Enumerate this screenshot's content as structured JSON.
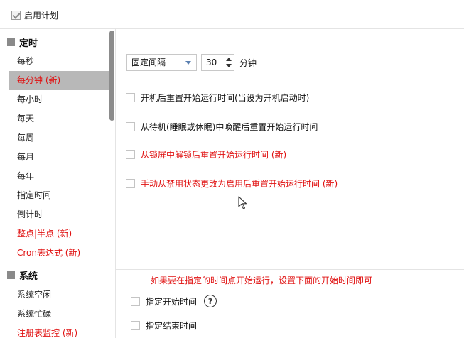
{
  "enable_plan": {
    "label": "启用计划",
    "checked": true
  },
  "sidebar": {
    "groups": [
      {
        "title": "定时"
      },
      {
        "title": "系统"
      }
    ],
    "items": [
      {
        "label": "每秒",
        "highlight": false
      },
      {
        "label": "每分钟 (新)",
        "highlight": true,
        "selected": true
      },
      {
        "label": "每小时",
        "highlight": false
      },
      {
        "label": "每天",
        "highlight": false
      },
      {
        "label": "每周",
        "highlight": false
      },
      {
        "label": "每月",
        "highlight": false
      },
      {
        "label": "每年",
        "highlight": false
      },
      {
        "label": "指定时间",
        "highlight": false
      },
      {
        "label": "倒计时",
        "highlight": false
      },
      {
        "label": "整点|半点 (新)",
        "highlight": true
      },
      {
        "label": "Cron表达式 (新)",
        "highlight": true
      },
      {
        "label": "系统空闲",
        "highlight": false
      },
      {
        "label": "系统忙碌",
        "highlight": false
      },
      {
        "label": "注册表监控 (新)",
        "highlight": true
      }
    ]
  },
  "main": {
    "mode_select": {
      "value": "固定间隔"
    },
    "interval": {
      "value": "30",
      "unit": "分钟"
    },
    "options": [
      {
        "label": "开机后重置开始运行时间(当设为开机启动时)",
        "red": false,
        "checked": false
      },
      {
        "label": "从待机(睡眠或休眠)中唤醒后重置开始运行时间",
        "red": false,
        "checked": false
      },
      {
        "label": "从锁屏中解锁后重置开始运行时间 (新)",
        "red": true,
        "checked": false
      },
      {
        "label": "手动从禁用状态更改为启用后重置开始运行时间 (新)",
        "red": true,
        "checked": false
      }
    ],
    "start_hint": "如果要在指定的时间点开始运行，设置下面的开始时间即可",
    "start_time": {
      "label": "指定开始时间",
      "checked": false
    },
    "end_time": {
      "label": "指定结束时间",
      "checked": false
    },
    "help_glyph": "?"
  },
  "colors": {
    "accent_red": "#e01010",
    "selected_bg": "#b8b8b8"
  },
  "icons": {
    "help": "question-circle-icon",
    "cursor": "mouse-pointer-icon"
  }
}
